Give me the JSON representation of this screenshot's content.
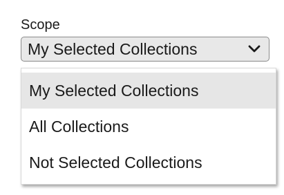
{
  "scope": {
    "label": "Scope",
    "selected_value": "My Selected Collections",
    "options": [
      {
        "label": "My Selected Collections",
        "highlighted": true
      },
      {
        "label": "All Collections",
        "highlighted": false
      },
      {
        "label": "Not Selected Collections",
        "highlighted": false
      }
    ]
  },
  "icons": {
    "dropdown": "chevron-down-icon"
  },
  "colors": {
    "select_background": "#e8e8e8",
    "highlight_background": "#e6e6e6",
    "text": "#1a1a1a"
  }
}
